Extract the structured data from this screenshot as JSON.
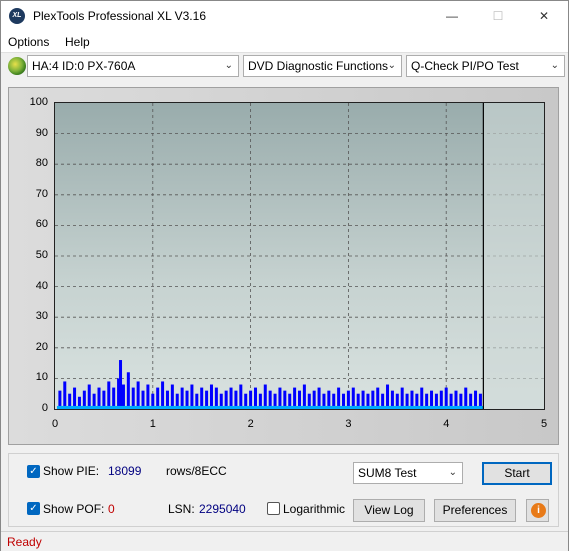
{
  "window": {
    "title": "PlexTools Professional XL V3.16",
    "icon_text": "XL"
  },
  "menu": [
    {
      "label": "Options"
    },
    {
      "label": "Help"
    }
  ],
  "toolbar": {
    "drive": "HA:4 ID:0  PX-760A",
    "function": "DVD Diagnostic Functions",
    "test": "Q-Check PI/PO Test"
  },
  "colors": {
    "series": "#0000ff",
    "baseline": "#00aaff",
    "status": "#c00000",
    "pof": "#c00000",
    "value": "#000080"
  },
  "chart_data": {
    "type": "bar",
    "xlim": [
      0,
      5
    ],
    "ylim": [
      0,
      100
    ],
    "x_ticks": [
      "0",
      "1",
      "2",
      "3",
      "4",
      "5"
    ],
    "y_ticks": [
      "0",
      "10",
      "20",
      "30",
      "40",
      "50",
      "60",
      "70",
      "80",
      "90",
      "100"
    ],
    "grid": true,
    "end_marker_x": 4.38,
    "series": [
      {
        "values_desc": "PIE per 8ECC",
        "x": [
          0.05,
          0.1,
          0.15,
          0.2,
          0.25,
          0.3,
          0.35,
          0.4,
          0.45,
          0.5,
          0.55,
          0.6,
          0.65,
          0.67,
          0.7,
          0.75,
          0.8,
          0.85,
          0.9,
          0.95,
          1.0,
          1.05,
          1.1,
          1.15,
          1.2,
          1.25,
          1.3,
          1.35,
          1.4,
          1.45,
          1.5,
          1.55,
          1.6,
          1.65,
          1.7,
          1.75,
          1.8,
          1.85,
          1.9,
          1.95,
          2.0,
          2.05,
          2.1,
          2.15,
          2.2,
          2.25,
          2.3,
          2.35,
          2.4,
          2.45,
          2.5,
          2.55,
          2.6,
          2.65,
          2.7,
          2.75,
          2.8,
          2.85,
          2.9,
          2.95,
          3.0,
          3.05,
          3.1,
          3.15,
          3.2,
          3.25,
          3.3,
          3.35,
          3.4,
          3.45,
          3.5,
          3.55,
          3.6,
          3.65,
          3.7,
          3.75,
          3.8,
          3.85,
          3.9,
          3.95,
          4.0,
          4.05,
          4.1,
          4.15,
          4.2,
          4.25,
          4.3,
          4.35
        ],
        "y": [
          6,
          9,
          5,
          7,
          4,
          6,
          8,
          5,
          7,
          6,
          9,
          7,
          10,
          16,
          8,
          12,
          7,
          9,
          6,
          8,
          5,
          7,
          9,
          6,
          8,
          5,
          7,
          6,
          8,
          5,
          7,
          6,
          8,
          7,
          5,
          6,
          7,
          6,
          8,
          5,
          6,
          7,
          5,
          8,
          6,
          5,
          7,
          6,
          5,
          7,
          6,
          8,
          5,
          6,
          7,
          5,
          6,
          5,
          7,
          5,
          6,
          7,
          5,
          6,
          5,
          6,
          7,
          5,
          8,
          6,
          5,
          7,
          5,
          6,
          5,
          7,
          5,
          6,
          5,
          6,
          7,
          5,
          6,
          5,
          7,
          5,
          6,
          5
        ]
      }
    ]
  },
  "bottom": {
    "show_pie_label": "Show PIE:",
    "pie_value": "18099",
    "pie_unit": "rows/8ECC",
    "show_pof_label": "Show POF:",
    "pof_value": "0",
    "lsn_label": "LSN:",
    "lsn_value": "2295040",
    "log_label": "Logarithmic",
    "test_select": "SUM8 Test",
    "start_label": "Start",
    "view_log_label": "View Log",
    "preferences_label": "Preferences"
  },
  "status": {
    "text": "Ready"
  }
}
